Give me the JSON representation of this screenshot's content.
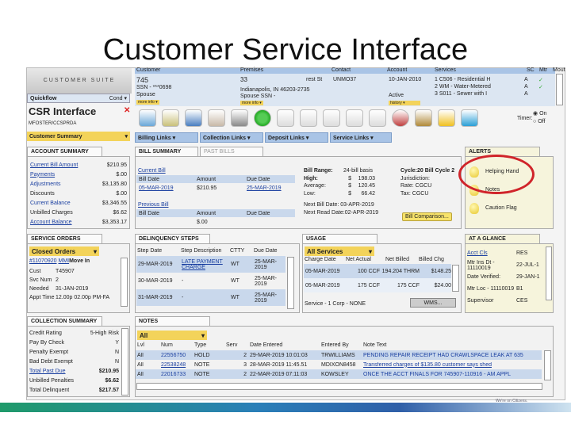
{
  "slide": {
    "title": "Customer Service Interface",
    "footer": "We're on Citizens."
  },
  "left": {
    "suite": "CUSTOMER SUITE",
    "quickflow": "Quickflow",
    "quickflow_select": "Cond",
    "app_title": "CSR Interface",
    "user_id": "MFOSTER/CCSPRDA",
    "summary_select": "Customer Summary"
  },
  "header": {
    "cols": [
      "Customer",
      "Premises",
      "Contact",
      "Account",
      "Services",
      "SC",
      "Mtr",
      "Mout"
    ],
    "customer": {
      "id": "745",
      "ssn": "SSN - ***0698",
      "spouse": "Spouse",
      "dd": "more info"
    },
    "premises": {
      "num": "33",
      "street": "rest St",
      "city": "Indianapolis, IN 46203-2735",
      "spouse_ssn": "Spouse SSN -",
      "dd": "more info"
    },
    "contact": "UNMO37",
    "account": {
      "date": "10-JAN-2010",
      "status": "Active",
      "dd": "history"
    },
    "services": [
      {
        "text": "1 C506 - Residential H",
        "sc": "A",
        "mtr": "✓"
      },
      {
        "text": "2 WM - Water-Metered",
        "sc": "A",
        "mtr": "✓"
      },
      {
        "text": "3 S011 - Sewer with I",
        "sc": "A",
        "mtr": ""
      }
    ]
  },
  "toolbar": {
    "icons": [
      "search-icon",
      "notebook-icon",
      "user-icon",
      "building-icon",
      "printer-icon",
      "power-icon",
      "calendar-icon",
      "calendar-clock-icon",
      "calendar-icon",
      "calendar-list-icon",
      "calendar-money-icon",
      "target-icon",
      "plumbing-icon",
      "hardhat-icon",
      "notepad-icon"
    ],
    "timer": "Timer:",
    "on": "On",
    "off": "Off"
  },
  "links": [
    "Billing Links",
    "Collection Links",
    "Deposit Links",
    "Service Links"
  ],
  "account_summary": {
    "tab": "ACCOUNT SUMMARY",
    "rows": [
      {
        "label": "Current Bill Amount",
        "value": "$210.95",
        "link": true
      },
      {
        "label": "Payments",
        "value": "$.00",
        "link": true
      },
      {
        "label": "Adjustments",
        "value": "$3,135.80",
        "link": false,
        "blue": true
      },
      {
        "label": "Discounts",
        "value": "$.00",
        "link": false
      },
      {
        "label": "Current Balance",
        "value": "$3,346.55",
        "link": false,
        "blue": true
      },
      {
        "label": "Unbilled Charges",
        "value": "$6.62",
        "link": false
      },
      {
        "label": "Account Balance",
        "value": "$3,353.17",
        "link": true
      }
    ]
  },
  "bill_summary": {
    "tabs": [
      "BILL SUMMARY",
      "PAST BILLS"
    ],
    "current": "Current Bill",
    "prev": "Previous Bill",
    "cols": [
      "Bill Date",
      "Amount",
      "Due Date"
    ],
    "current_row": [
      "05-MAR-2019",
      "$210.95",
      "25-MAR-2019"
    ],
    "prev_row": [
      "",
      "$.00",
      ""
    ],
    "range_label": "Bill Range:",
    "range_val": "24-bill basis",
    "stats": [
      {
        "l": "High:",
        "c": "$",
        "v": "198.03"
      },
      {
        "l": "Average:",
        "c": "$",
        "v": "120.45"
      },
      {
        "l": "Low:",
        "c": "$",
        "v": "66.42"
      }
    ],
    "next_bill": "Next Bill Date:  03-APR-2019",
    "next_read": "Next Read Date:02-APR-2019",
    "cycle": "Cycle:20 Bill Cycle 2",
    "jurisdiction": "Jurisdiction:",
    "rate": "Rate:  CGCU",
    "tax": "Tax:   CGCU",
    "compare": "Bill Comparison..."
  },
  "alerts": {
    "tab": "ALERTS",
    "items": [
      "Helping Hand",
      "Notes",
      "Caution Flag"
    ]
  },
  "service_orders": {
    "tab": "SERVICE ORDERS",
    "select": "Closed Orders",
    "order": "#11070920",
    "order_type": "MMI",
    "order_desc": "Move In",
    "rows": [
      [
        "Cust",
        "T45907"
      ],
      [
        "Svc Num",
        "2"
      ],
      [
        "Needed",
        "31-JAN-2019"
      ],
      [
        "Appt Time",
        "12.00p 02.00p PM-FA"
      ]
    ]
  },
  "delinquency": {
    "tab": "DELINQUENCY STEPS",
    "cols": [
      "Step Date",
      "Step Description",
      "CTTY",
      "Due Date"
    ],
    "rows": [
      [
        "29-MAR-2019",
        "LATE PAYMENT CHARGE",
        "WT",
        "25-MAR-2019"
      ],
      [
        "30-MAR-2019",
        "-",
        "WT",
        "25-MAR-2019"
      ],
      [
        "31-MAR-2019",
        "-",
        "WT",
        "25-MAR-2019"
      ]
    ]
  },
  "usage": {
    "tab": "USAGE",
    "select": "All Services",
    "cols": [
      "Charge Date",
      "Net Actual",
      "Net Billed",
      "Billed Chg"
    ],
    "rows": [
      [
        "05-MAR-2019",
        "100 CCF",
        "194.204 THRM",
        "$148.25"
      ],
      [
        "05-MAR-2019",
        "175 CCF",
        "175 CCF",
        "$24.00"
      ]
    ],
    "footer": "Service - 1  Corp -  NONE",
    "button": "WMS..."
  },
  "glance": {
    "tab": "AT A GLANCE",
    "rows": [
      [
        "Acct Cls",
        "RES"
      ],
      [
        "Mtr Ins Dt - 11110019",
        "22-JUL-1"
      ],
      [
        "Date Verified:",
        "29-JAN-1"
      ],
      [
        "Mtr Loc - 11110019",
        "B1"
      ],
      [
        "Supervisor",
        "CES"
      ]
    ]
  },
  "collection": {
    "tab": "COLLECTION SUMMARY",
    "rows": [
      {
        "l": "Credit Rating",
        "v": "5-High Risk",
        "link": false
      },
      {
        "l": "Pay By Check",
        "v": "Y",
        "link": false
      },
      {
        "l": "Penalty Exempt",
        "v": "N",
        "link": false
      },
      {
        "l": "Bad Debt Exempt",
        "v": "N",
        "link": false
      },
      {
        "l": "Total Past Due",
        "v": "$210.95",
        "link": true
      },
      {
        "l": "Unbilled Penalties",
        "v": "$6.62",
        "link": false
      },
      {
        "l": "Total Delinquent",
        "v": "$217.57",
        "link": false
      }
    ]
  },
  "notes": {
    "tab": "NOTES",
    "select": "All",
    "cols": [
      "Lvl",
      "Num",
      "Type",
      "Serv",
      "Date Entered",
      "Entered By",
      "Note Text"
    ],
    "rows": [
      [
        "All",
        "22556750",
        "HOLD",
        "2",
        "29-MAR-2019 10:01:03",
        "TRWILLIAMS",
        "PENDING REPAIR RECEIPT HAD CRAWLSPACE LEAK AT 635"
      ],
      [
        "All",
        "22538248",
        "NOTE",
        "3",
        "28-MAR-2019 11:45.51",
        "MDIXON8458",
        "Transferred charges of $135.80 customer says shed"
      ],
      [
        "All",
        "22016733",
        "NOTE",
        "2",
        "22-MAR-2019 07:11:03",
        "KOWSLEY",
        "ONCE THE ACCT FINALS FOR 745907-110916 - AM APPL"
      ]
    ]
  }
}
